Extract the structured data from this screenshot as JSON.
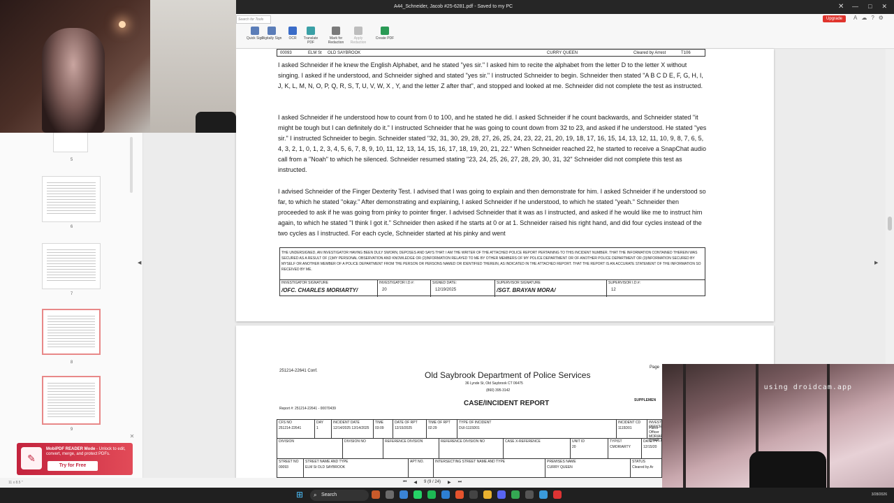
{
  "window": {
    "title": "A44_Schneider, Jacob #25-6281.pdf - Saved to my PC",
    "controls": [
      "—",
      "□",
      "✕"
    ]
  },
  "ribbon": {
    "search_placeholder": "Search for Tools",
    "tools": [
      {
        "label": "Quick Sign",
        "color": "#5b7db8"
      },
      {
        "label": "Digitally Sign",
        "color": "#5b7db8"
      },
      {
        "label": "OCR",
        "color": "#3a6cc8"
      },
      {
        "label": "Translate PDF",
        "color": "#3aa0a6"
      },
      {
        "label": "Mark for Redaction",
        "color": "#7a7a7a"
      },
      {
        "label": "Apply Redaction",
        "color": "#bdbdbd"
      },
      {
        "label": "Create PDF",
        "color": "#2a9a55"
      }
    ],
    "upgrade_label": "Upgrade"
  },
  "thumbnails": {
    "pages": [
      {
        "num": "5",
        "selected": false
      },
      {
        "num": "6",
        "selected": false
      },
      {
        "num": "7",
        "selected": false
      },
      {
        "num": "8",
        "selected": true
      },
      {
        "num": "9",
        "selected": true
      }
    ]
  },
  "promo": {
    "title": "MobiPDF READER Mode",
    "text": " - Unlock to edit, convert, merge, and protect PDFs.",
    "button": "Try for Free"
  },
  "page1": {
    "header_row": {
      "street_no": "00093",
      "street": "ELM St",
      "city": "OLD SAYBROOK",
      "premises": "CURRY QUEEN",
      "status": "Cleared by Arrest",
      "code": "T106"
    },
    "paragraphs": [
      "I asked Schneider if he knew the English Alphabet, and he stated \"yes sir.\"  I asked him to recite the alphabet from the letter D to the letter X without singing. I asked if he understood, and Schneider sighed and stated \"yes sir.\" I instructed Schneider to begin. Schneider then stated \"A B C D E, F, G, H, I, J, K, L, M, N, O, P, Q, R, S, T, U, V, W, X , Y, and the letter Z after that\", and stopped and looked at me. Schneider did not complete the test as instructed.",
      "I asked Schneider if he understood how to count from 0 to 100, and he stated he did. I asked Schneider if he count backwards, and Schneider stated \"it might be tough but I can definitely do it.\" I instructed Schneider that he was going to count down from 32 to 23, and asked if he understood. He stated \"yes sir.\" I instructed Schneider to begin. Schneider stated \"32, 31, 30, 29, 28, 27, 26, 25, 24, 23, 22, 21, 20, 19, 18, 17, 16, 15, 14, 13, 12, 11, 10, 9, 8, 7, 6, 5, 4, 3, 2, 1, 0, 1, 2, 3, 4, 5, 6, 7, 8, 9, 10, 11, 12, 13, 14, 15, 16, 17, 18, 19, 20, 21, 22.\" When Schneider reached 22, he started to receive a SnapChat audio call from a \"Noah\" to which he silenced. Schneider resumed stating \"23, 24, 25, 26, 27, 28, 29, 30, 31, 32\"  Schneider did not complete this test as instructed.",
      "I advised Schneider of the Finger Dexterity Test. I advised that I was going to explain and then demonstrate for him. I asked Schneider if he understood so far, to which he stated \"okay.\" After demonstrating and explaining, I asked Schneider if he understood, to which he stated \"yeah.\" Schneider then proceeded to ask if he was going from pinky to pointer finger. I advised Schneider that it was as I instructed, and asked if he would like me to instruct him again, to which he stated \"I think I got it.\" Schneider then asked if he starts at 0 or at 1. Schneider raised his right hand, and did four cycles instead of the two cycles as I instructed. For each cycle, Schneider started at his pinky and went"
    ],
    "certification": "THE UNDERSIGNED, AN INVESTIGATOR HAVING BEEN DULY SWORN, DEPOSES AND SAYS THAT: I AM THE WRITER OF THE ATTACHED POLICE REPORT PERTAINING TO THIS INCIDENT NUMBER. THAT THE INFORMATION CONTAINED THEREIN WAS SECURED AS A RESULT OF (1)MY PERSONAL OBSERVATION AND KNOWLEDGE OR (2)INFORMATION RELAYED TO ME BY OTHER MEMBERS OF MY POLICE DEPARTMENT OR OF ANOTHER POLICE DEPARTMENT OR (3)INFORMATION SECURED BY MYSELF OR ANOTHER MEMBER OF A POLICE DEPARTMENT FROM THE PERSON OR PERSONS NAMED OR IDENTIFIED THEREIN, AS INDICATED IN THE ATTACHED REPORT. THAT THE REPORT IS AN ACCURATE STATEMENT OF THE INFORMATION SO RECEIVED BY ME.",
    "signatures": {
      "inv_sig_label": "INVESTIGATOR SIGNATURE",
      "inv_sig": "/OFC. CHARLES MORIARTY/",
      "inv_id_label": "INVESTIGATOR I.D.#:",
      "inv_id": "20",
      "signed_label": "SIGNED DATE:",
      "signed": "12/19/2025",
      "sup_sig_label": "SUPERVISOR SIGNATURE",
      "sup_sig": "/SGT. BRAYAN MORA/",
      "sup_id_label": "SUPERVISOR I.D.#:",
      "sup_id": "12"
    }
  },
  "page2": {
    "conf": "251214-22641 Conf.",
    "dept": "Old Saybrook Department of Police Services",
    "address": "36 Lynde St, Old Saybrook  CT 06475",
    "phone": "(860) 395-3142",
    "case_title": "CASE/INCIDENT REPORT",
    "page_label": "Page",
    "supplement": "SUPPLEMEN",
    "report_no": "Report #: 251214-22641 - 00070439",
    "row1": [
      {
        "l": "CFS NO",
        "v": "251214-22641"
      },
      {
        "l": "DAY",
        "v": "1"
      },
      {
        "l": "INCIDENT DATE",
        "v": "12/14/2025  12/14/2025"
      },
      {
        "l": "TIME",
        "v": "03:09"
      },
      {
        "l": "DATE OF RPT",
        "v": "12/15/2025"
      },
      {
        "l": "TIME OF RPT",
        "v": "02:29"
      },
      {
        "l": "TYPE OF INCIDENT",
        "v": "DUI-1115D01"
      },
      {
        "l": "INCIDENT CD",
        "v": "1115D01"
      },
      {
        "l": "INVESTIGATING OFFICER",
        "v": "Patrol Officer  MORIARTY, CHARLES"
      }
    ],
    "row2": [
      {
        "l": "DIVISION",
        "v": ""
      },
      {
        "l": "DIVISION NO",
        "v": ""
      },
      {
        "l": "REFERENCE DIVISION",
        "v": ""
      },
      {
        "l": "REFERENCE DIVISION NO",
        "v": ""
      },
      {
        "l": "CASE X-REFERENCE",
        "v": ""
      },
      {
        "l": "UNIT ID",
        "v": "20"
      },
      {
        "l": "TYPIST",
        "v": "CMORIARTY"
      },
      {
        "l": "DATE TY",
        "v": "12/15/20"
      }
    ],
    "row3": [
      {
        "l": "STREET NO",
        "v": "00093"
      },
      {
        "l": "STREET NAME AND TYPE",
        "v": "ELM St   OLD SAYBROOK"
      },
      {
        "l": "APT NO.",
        "v": ""
      },
      {
        "l": "INTERSECTING STREET NAME AND TYPE",
        "v": ""
      },
      {
        "l": "PREMISES NAME",
        "v": "CURRY QUEEN"
      },
      {
        "l": "STATUS",
        "v": "Cleared by Ar"
      }
    ]
  },
  "webcam": {
    "overlay": "using droidcam.app"
  },
  "pagenav": {
    "page_info": "9  (9 / 24)",
    "dims": "11 x 8.5 \""
  },
  "taskbar": {
    "search": "Search",
    "date": "3/28/2026"
  }
}
